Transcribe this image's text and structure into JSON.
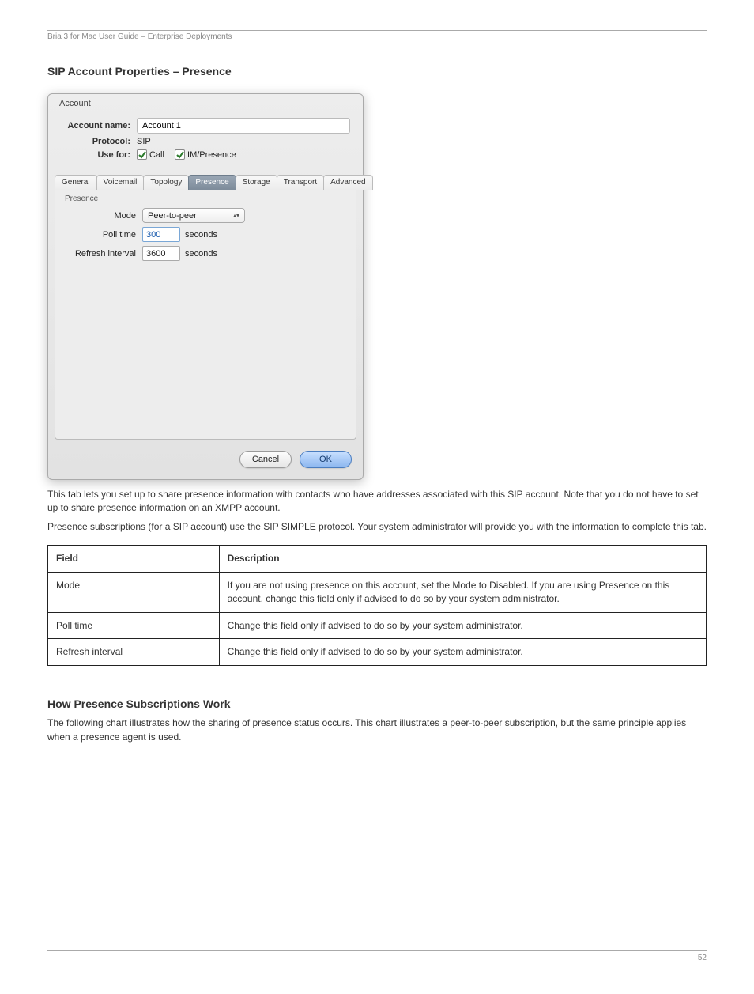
{
  "header": {
    "left": "Bria 3 for Mac User Guide – Enterprise Deployments"
  },
  "window": {
    "title": "Account",
    "account_name_label": "Account name:",
    "account_name_value": "Account 1",
    "protocol_label": "Protocol:",
    "protocol_value": "SIP",
    "use_for_label": "Use for:",
    "use_for_call": "Call",
    "use_for_im": "IM/Presence",
    "tabs": [
      "General",
      "Voicemail",
      "Topology",
      "Presence",
      "Storage",
      "Transport",
      "Advanced"
    ],
    "active_tab_index": 3,
    "panel": {
      "group": "Presence",
      "mode_label": "Mode",
      "mode_value": "Peer-to-peer",
      "poll_label": "Poll time",
      "poll_value": "300",
      "poll_unit": "seconds",
      "refresh_label": "Refresh interval",
      "refresh_value": "3600",
      "refresh_unit": "seconds"
    },
    "buttons": {
      "cancel": "Cancel",
      "ok": "OK"
    }
  },
  "section": {
    "intro1": "This tab lets you set up to share presence information with contacts who have addresses associated with this SIP account. Note that you do not have to set up to share presence information on an XMPP account.",
    "intro2": "Presence subscriptions (for a SIP account) use the SIP SIMPLE protocol. Your system administrator will provide you with the information to complete this tab.",
    "table": {
      "headers": [
        "Field",
        "Description"
      ],
      "rows": [
        [
          "Mode",
          "If you are not using presence on this account, set the Mode to Disabled. If you are using Presence on this account, change this field only if advised to do so by your system administrator."
        ],
        [
          "Poll time",
          "Change this field only if advised to do so by your system administrator."
        ],
        [
          "Refresh interval",
          "Change this field only if advised to do so by your system administrator."
        ]
      ]
    }
  },
  "howworks": {
    "title": "How Presence Subscriptions Work",
    "p1": "The following chart illustrates how the sharing of presence status occurs. This chart illustrates a peer-to-peer subscription, but the same principle applies when a presence agent is used."
  },
  "footer": {
    "page": "52"
  }
}
